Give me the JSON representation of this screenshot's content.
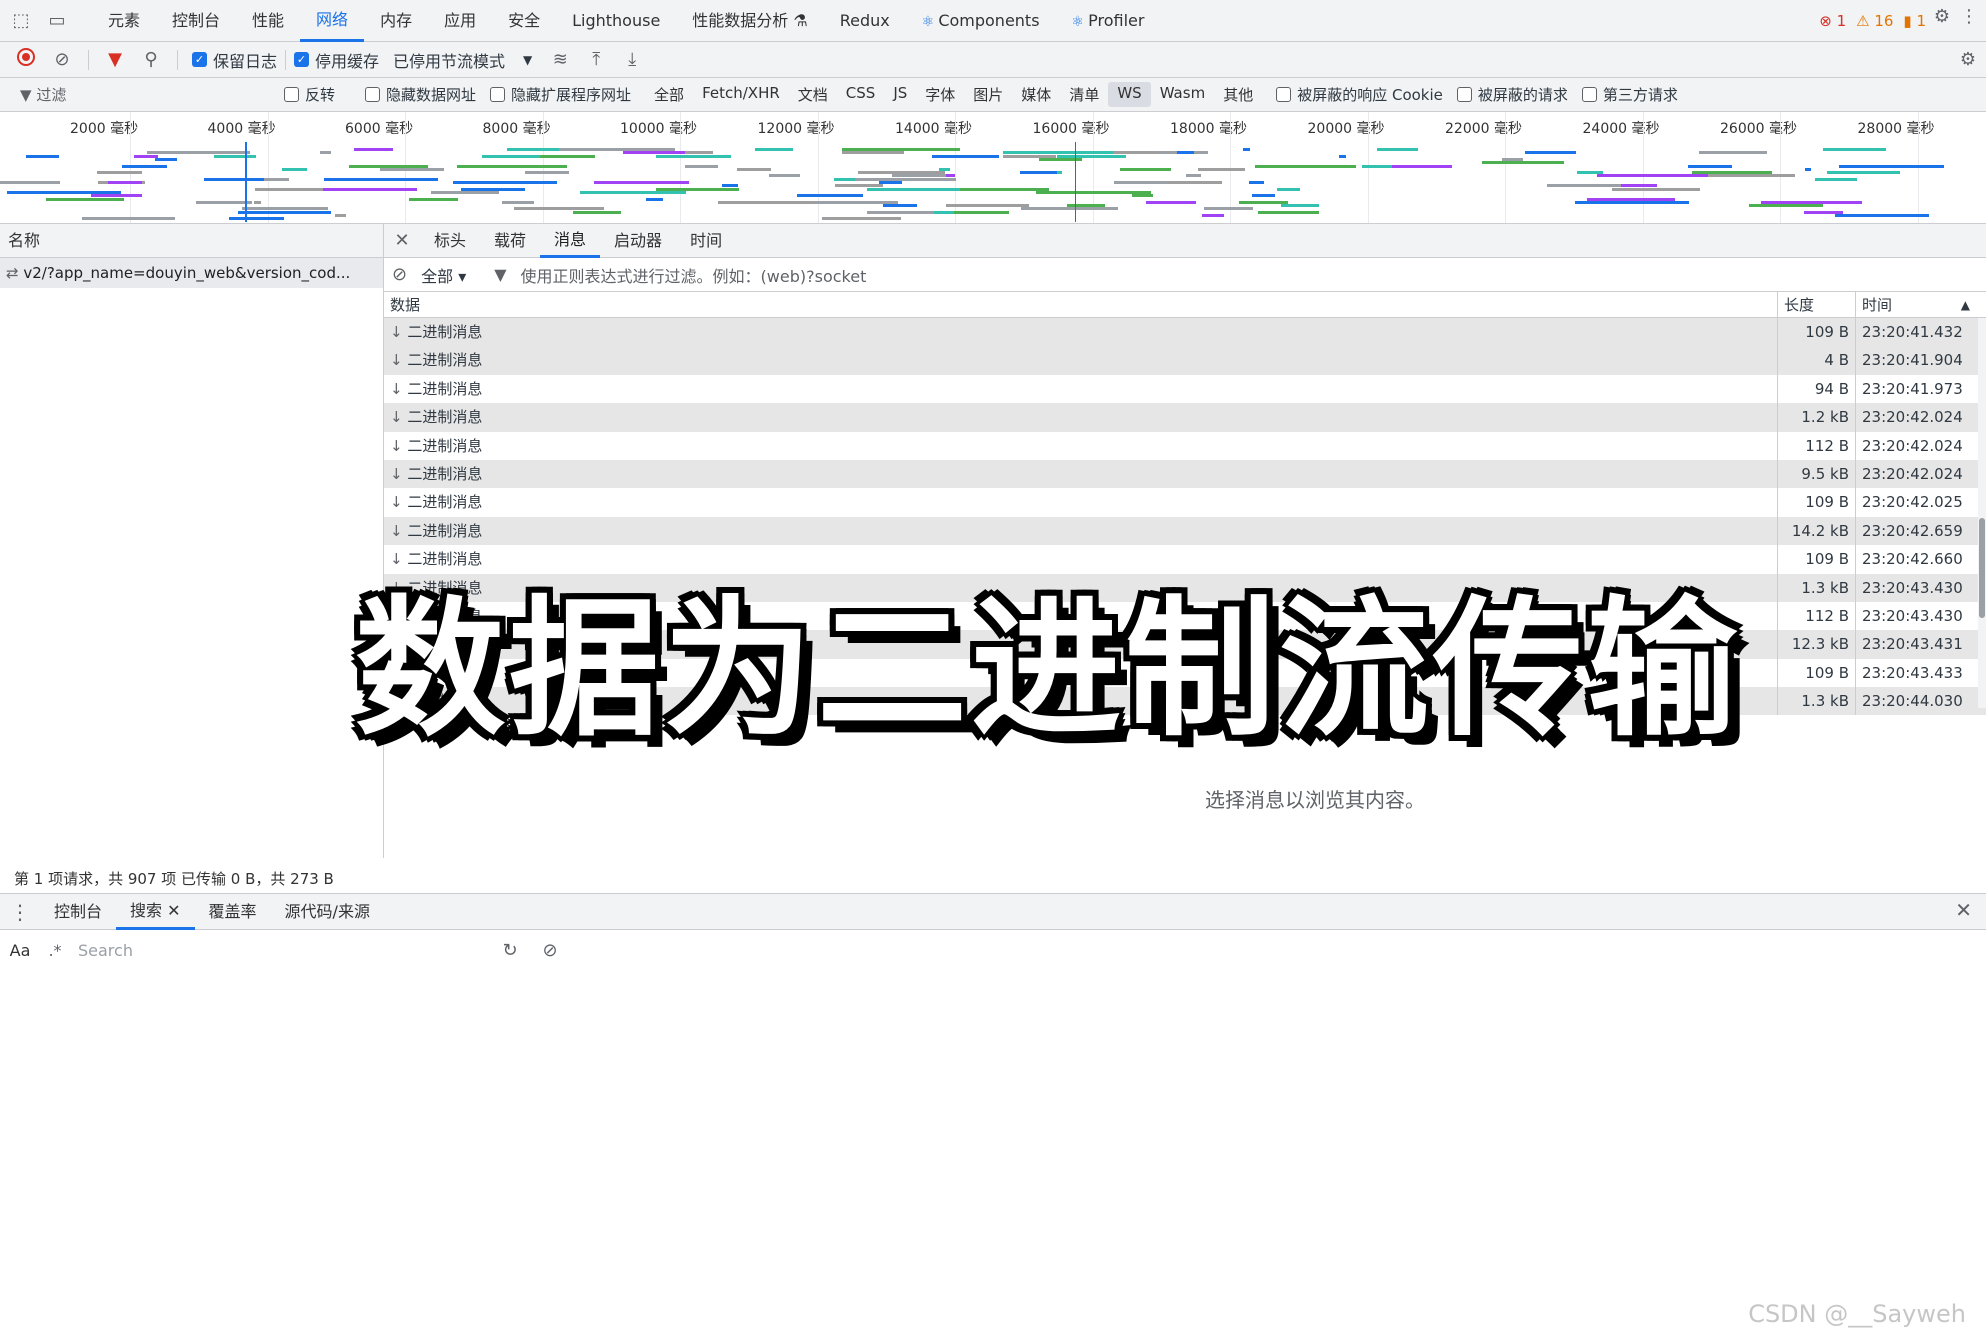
{
  "devtools_tabs": [
    {
      "label": "元素",
      "active": false
    },
    {
      "label": "控制台",
      "active": false
    },
    {
      "label": "性能",
      "active": false
    },
    {
      "label": "网络",
      "active": true
    },
    {
      "label": "内存",
      "active": false
    },
    {
      "label": "应用",
      "active": false
    },
    {
      "label": "安全",
      "active": false
    },
    {
      "label": "Lighthouse",
      "active": false
    },
    {
      "label": "性能数据分析 ⚗",
      "active": false
    },
    {
      "label": "Redux",
      "active": false
    },
    {
      "label": "Components",
      "active": false
    },
    {
      "label": "Profiler",
      "active": false
    }
  ],
  "counts": {
    "errors": "1",
    "warnings": "16",
    "issues": "1"
  },
  "toolbar": {
    "preserve_log": "保留日志",
    "disable_cache": "停用缓存",
    "throttle": "已停用节流模式"
  },
  "filterbar": {
    "filter_placeholder": "过滤",
    "invert": "反转",
    "hide_data_urls": "隐藏数据网址",
    "hide_ext_urls": "隐藏扩展程序网址",
    "types": [
      {
        "label": "全部",
        "active": false
      },
      {
        "label": "Fetch/XHR",
        "active": false
      },
      {
        "label": "文档",
        "active": false
      },
      {
        "label": "CSS",
        "active": false
      },
      {
        "label": "JS",
        "active": false
      },
      {
        "label": "字体",
        "active": false
      },
      {
        "label": "图片",
        "active": false
      },
      {
        "label": "媒体",
        "active": false
      },
      {
        "label": "清单",
        "active": false
      },
      {
        "label": "WS",
        "active": true
      },
      {
        "label": "Wasm",
        "active": false
      },
      {
        "label": "其他",
        "active": false
      }
    ],
    "blocked_cookies": "被屏蔽的响应 Cookie",
    "blocked_requests": "被屏蔽的请求",
    "third_party": "第三方请求"
  },
  "timeline_ticks": [
    "2000 毫秒",
    "4000 毫秒",
    "6000 毫秒",
    "8000 毫秒",
    "10000 毫秒",
    "12000 毫秒",
    "14000 毫秒",
    "16000 毫秒",
    "18000 毫秒",
    "20000 毫秒",
    "22000 毫秒",
    "24000 毫秒",
    "26000 毫秒",
    "28000 毫秒"
  ],
  "left": {
    "column_name": "名称",
    "request": "v2/?app_name=douyin_web&version_cod..."
  },
  "detail_tabs": [
    {
      "label": "标头",
      "active": false
    },
    {
      "label": "载荷",
      "active": false
    },
    {
      "label": "消息",
      "active": true
    },
    {
      "label": "启动器",
      "active": false
    },
    {
      "label": "时间",
      "active": false
    }
  ],
  "msg_filter": {
    "scope": "全部",
    "placeholder": "使用正则表达式进行过滤。例如：(web)?socket"
  },
  "grid": {
    "col_data": "数据",
    "col_length": "长度",
    "col_time": "时间",
    "rows": [
      {
        "data": "二进制消息",
        "length": "109 B",
        "time": "23:20:41.432"
      },
      {
        "data": "二进制消息",
        "length": "4 B",
        "time": "23:20:41.904"
      },
      {
        "data": "二进制消息",
        "length": "94 B",
        "time": "23:20:41.973"
      },
      {
        "data": "二进制消息",
        "length": "1.2 kB",
        "time": "23:20:42.024"
      },
      {
        "data": "二进制消息",
        "length": "112 B",
        "time": "23:20:42.024"
      },
      {
        "data": "二进制消息",
        "length": "9.5 kB",
        "time": "23:20:42.024"
      },
      {
        "data": "二进制消息",
        "length": "109 B",
        "time": "23:20:42.025"
      },
      {
        "data": "二进制消息",
        "length": "14.2 kB",
        "time": "23:20:42.659"
      },
      {
        "data": "二进制消息",
        "length": "109 B",
        "time": "23:20:42.660"
      },
      {
        "data": "二进制消息",
        "length": "1.3 kB",
        "time": "23:20:43.430"
      },
      {
        "data": "二进制消息",
        "length": "112 B",
        "time": "23:20:43.430"
      },
      {
        "data": "二进制消息",
        "length": "12.3 kB",
        "time": "23:20:43.431"
      },
      {
        "data": "二进制消息",
        "length": "109 B",
        "time": "23:20:43.433"
      },
      {
        "data": "二进制消息",
        "length": "1.3 kB",
        "time": "23:20:44.030"
      }
    ]
  },
  "hint": "选择消息以浏览其内容。",
  "overlay_caption": "数据为二进制流传输",
  "status_line": "第 1 项请求，共 907 项   已传输 0 B，共 273 B",
  "drawer_tabs": [
    {
      "label": "控制台",
      "active": false,
      "closable": false
    },
    {
      "label": "搜索",
      "active": true,
      "closable": true
    },
    {
      "label": "覆盖率",
      "active": false,
      "closable": false
    },
    {
      "label": "源代码/来源",
      "active": false,
      "closable": false
    }
  ],
  "search": {
    "case_label": "Aa",
    "regex_label": ".*",
    "placeholder": "Search"
  },
  "watermark": "CSDN @__Sayweh"
}
